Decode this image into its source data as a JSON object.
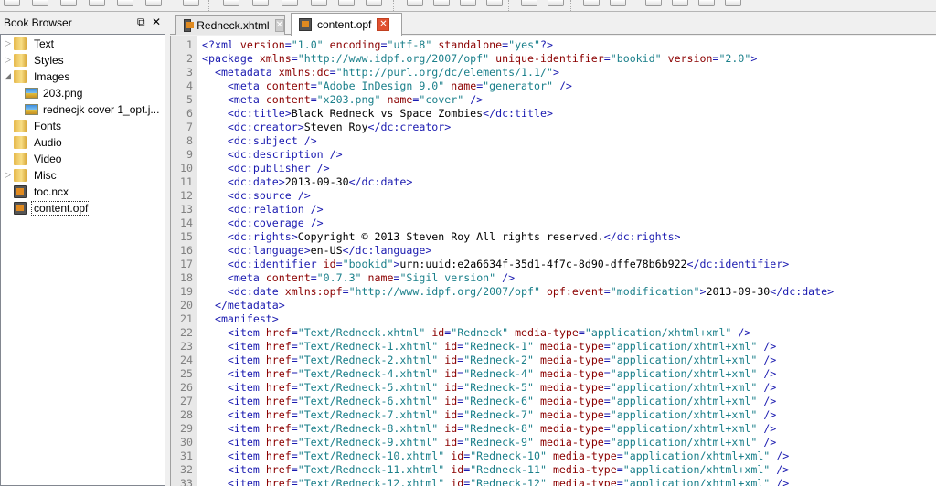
{
  "book_browser": {
    "title": "Book Browser",
    "items": [
      {
        "label": "Text",
        "type": "folder",
        "expanded": false
      },
      {
        "label": "Styles",
        "type": "folder",
        "expanded": false
      },
      {
        "label": "Images",
        "type": "folder",
        "expanded": true
      },
      {
        "label": "203.png",
        "type": "image"
      },
      {
        "label": "rednecjk cover 1_opt.j...",
        "type": "image"
      },
      {
        "label": "Fonts",
        "type": "folder"
      },
      {
        "label": "Audio",
        "type": "folder"
      },
      {
        "label": "Video",
        "type": "folder"
      },
      {
        "label": "Misc",
        "type": "folder",
        "expanded": false
      },
      {
        "label": "toc.ncx",
        "type": "file"
      },
      {
        "label": "content.opf",
        "type": "file",
        "selected": true
      }
    ]
  },
  "tabs": [
    {
      "label": "Redneck.xhtml",
      "active": false
    },
    {
      "label": "content.opf",
      "active": true
    }
  ],
  "editor": {
    "lines": [
      "<?xml version=\"1.0\" encoding=\"utf-8\" standalone=\"yes\"?>",
      "<package xmlns=\"http://www.idpf.org/2007/opf\" unique-identifier=\"bookid\" version=\"2.0\">",
      "  <metadata xmlns:dc=\"http://purl.org/dc/elements/1.1/\">",
      "    <meta content=\"Adobe InDesign 9.0\" name=\"generator\" />",
      "    <meta content=\"x203.png\" name=\"cover\" />",
      "    <dc:title>Black Redneck vs Space Zombies</dc:title>",
      "    <dc:creator>Steven Roy</dc:creator>",
      "    <dc:subject />",
      "    <dc:description />",
      "    <dc:publisher />",
      "    <dc:date>2013-09-30</dc:date>",
      "    <dc:source />",
      "    <dc:relation />",
      "    <dc:coverage />",
      "    <dc:rights>Copyright © 2013 Steven Roy All rights reserved.</dc:rights>",
      "    <dc:language>en-US</dc:language>",
      "    <dc:identifier id=\"bookid\">urn:uuid:e2a6634f-35d1-4f7c-8d90-dffe78b6b922</dc:identifier>",
      "    <meta content=\"0.7.3\" name=\"Sigil version\" />",
      "    <dc:date xmlns:opf=\"http://www.idpf.org/2007/opf\" opf:event=\"modification\">2013-09-30</dc:date>",
      "  </metadata>",
      "  <manifest>",
      "    <item href=\"Text/Redneck.xhtml\" id=\"Redneck\" media-type=\"application/xhtml+xml\" />",
      "    <item href=\"Text/Redneck-1.xhtml\" id=\"Redneck-1\" media-type=\"application/xhtml+xml\" />",
      "    <item href=\"Text/Redneck-2.xhtml\" id=\"Redneck-2\" media-type=\"application/xhtml+xml\" />",
      "    <item href=\"Text/Redneck-4.xhtml\" id=\"Redneck-4\" media-type=\"application/xhtml+xml\" />",
      "    <item href=\"Text/Redneck-5.xhtml\" id=\"Redneck-5\" media-type=\"application/xhtml+xml\" />",
      "    <item href=\"Text/Redneck-6.xhtml\" id=\"Redneck-6\" media-type=\"application/xhtml+xml\" />",
      "    <item href=\"Text/Redneck-7.xhtml\" id=\"Redneck-7\" media-type=\"application/xhtml+xml\" />",
      "    <item href=\"Text/Redneck-8.xhtml\" id=\"Redneck-8\" media-type=\"application/xhtml+xml\" />",
      "    <item href=\"Text/Redneck-9.xhtml\" id=\"Redneck-9\" media-type=\"application/xhtml+xml\" />",
      "    <item href=\"Text/Redneck-10.xhtml\" id=\"Redneck-10\" media-type=\"application/xhtml+xml\" />",
      "    <item href=\"Text/Redneck-11.xhtml\" id=\"Redneck-11\" media-type=\"application/xhtml+xml\" />",
      "    <item href=\"Text/Redneck-12.xhtml\" id=\"Redneck-12\" media-type=\"application/xhtml+xml\" />"
    ]
  }
}
